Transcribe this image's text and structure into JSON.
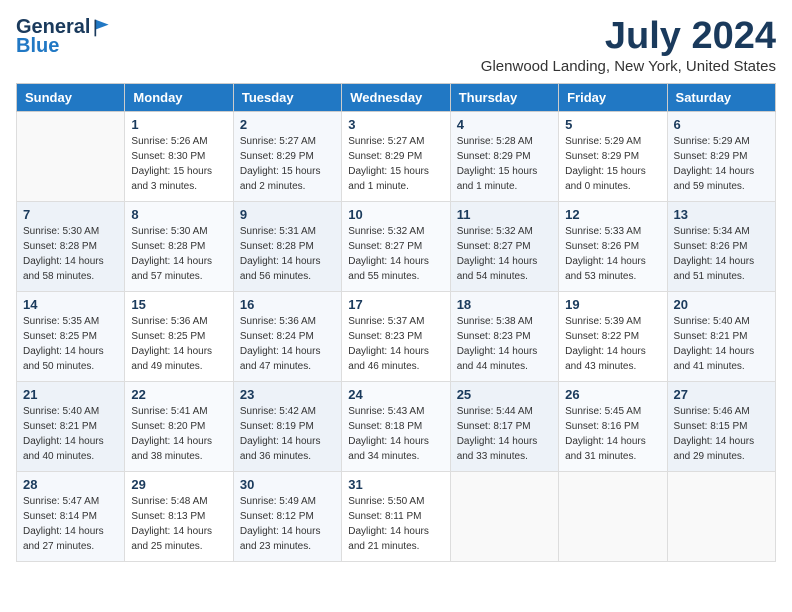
{
  "header": {
    "logo_general": "General",
    "logo_blue": "Blue",
    "month_title": "July 2024",
    "location": "Glenwood Landing, New York, United States"
  },
  "weekdays": [
    "Sunday",
    "Monday",
    "Tuesday",
    "Wednesday",
    "Thursday",
    "Friday",
    "Saturday"
  ],
  "weeks": [
    [
      {
        "day": "",
        "sunrise": "",
        "sunset": "",
        "daylight": ""
      },
      {
        "day": "1",
        "sunrise": "Sunrise: 5:26 AM",
        "sunset": "Sunset: 8:30 PM",
        "daylight": "Daylight: 15 hours and 3 minutes."
      },
      {
        "day": "2",
        "sunrise": "Sunrise: 5:27 AM",
        "sunset": "Sunset: 8:29 PM",
        "daylight": "Daylight: 15 hours and 2 minutes."
      },
      {
        "day": "3",
        "sunrise": "Sunrise: 5:27 AM",
        "sunset": "Sunset: 8:29 PM",
        "daylight": "Daylight: 15 hours and 1 minute."
      },
      {
        "day": "4",
        "sunrise": "Sunrise: 5:28 AM",
        "sunset": "Sunset: 8:29 PM",
        "daylight": "Daylight: 15 hours and 1 minute."
      },
      {
        "day": "5",
        "sunrise": "Sunrise: 5:29 AM",
        "sunset": "Sunset: 8:29 PM",
        "daylight": "Daylight: 15 hours and 0 minutes."
      },
      {
        "day": "6",
        "sunrise": "Sunrise: 5:29 AM",
        "sunset": "Sunset: 8:29 PM",
        "daylight": "Daylight: 14 hours and 59 minutes."
      }
    ],
    [
      {
        "day": "7",
        "sunrise": "Sunrise: 5:30 AM",
        "sunset": "Sunset: 8:28 PM",
        "daylight": "Daylight: 14 hours and 58 minutes."
      },
      {
        "day": "8",
        "sunrise": "Sunrise: 5:30 AM",
        "sunset": "Sunset: 8:28 PM",
        "daylight": "Daylight: 14 hours and 57 minutes."
      },
      {
        "day": "9",
        "sunrise": "Sunrise: 5:31 AM",
        "sunset": "Sunset: 8:28 PM",
        "daylight": "Daylight: 14 hours and 56 minutes."
      },
      {
        "day": "10",
        "sunrise": "Sunrise: 5:32 AM",
        "sunset": "Sunset: 8:27 PM",
        "daylight": "Daylight: 14 hours and 55 minutes."
      },
      {
        "day": "11",
        "sunrise": "Sunrise: 5:32 AM",
        "sunset": "Sunset: 8:27 PM",
        "daylight": "Daylight: 14 hours and 54 minutes."
      },
      {
        "day": "12",
        "sunrise": "Sunrise: 5:33 AM",
        "sunset": "Sunset: 8:26 PM",
        "daylight": "Daylight: 14 hours and 53 minutes."
      },
      {
        "day": "13",
        "sunrise": "Sunrise: 5:34 AM",
        "sunset": "Sunset: 8:26 PM",
        "daylight": "Daylight: 14 hours and 51 minutes."
      }
    ],
    [
      {
        "day": "14",
        "sunrise": "Sunrise: 5:35 AM",
        "sunset": "Sunset: 8:25 PM",
        "daylight": "Daylight: 14 hours and 50 minutes."
      },
      {
        "day": "15",
        "sunrise": "Sunrise: 5:36 AM",
        "sunset": "Sunset: 8:25 PM",
        "daylight": "Daylight: 14 hours and 49 minutes."
      },
      {
        "day": "16",
        "sunrise": "Sunrise: 5:36 AM",
        "sunset": "Sunset: 8:24 PM",
        "daylight": "Daylight: 14 hours and 47 minutes."
      },
      {
        "day": "17",
        "sunrise": "Sunrise: 5:37 AM",
        "sunset": "Sunset: 8:23 PM",
        "daylight": "Daylight: 14 hours and 46 minutes."
      },
      {
        "day": "18",
        "sunrise": "Sunrise: 5:38 AM",
        "sunset": "Sunset: 8:23 PM",
        "daylight": "Daylight: 14 hours and 44 minutes."
      },
      {
        "day": "19",
        "sunrise": "Sunrise: 5:39 AM",
        "sunset": "Sunset: 8:22 PM",
        "daylight": "Daylight: 14 hours and 43 minutes."
      },
      {
        "day": "20",
        "sunrise": "Sunrise: 5:40 AM",
        "sunset": "Sunset: 8:21 PM",
        "daylight": "Daylight: 14 hours and 41 minutes."
      }
    ],
    [
      {
        "day": "21",
        "sunrise": "Sunrise: 5:40 AM",
        "sunset": "Sunset: 8:21 PM",
        "daylight": "Daylight: 14 hours and 40 minutes."
      },
      {
        "day": "22",
        "sunrise": "Sunrise: 5:41 AM",
        "sunset": "Sunset: 8:20 PM",
        "daylight": "Daylight: 14 hours and 38 minutes."
      },
      {
        "day": "23",
        "sunrise": "Sunrise: 5:42 AM",
        "sunset": "Sunset: 8:19 PM",
        "daylight": "Daylight: 14 hours and 36 minutes."
      },
      {
        "day": "24",
        "sunrise": "Sunrise: 5:43 AM",
        "sunset": "Sunset: 8:18 PM",
        "daylight": "Daylight: 14 hours and 34 minutes."
      },
      {
        "day": "25",
        "sunrise": "Sunrise: 5:44 AM",
        "sunset": "Sunset: 8:17 PM",
        "daylight": "Daylight: 14 hours and 33 minutes."
      },
      {
        "day": "26",
        "sunrise": "Sunrise: 5:45 AM",
        "sunset": "Sunset: 8:16 PM",
        "daylight": "Daylight: 14 hours and 31 minutes."
      },
      {
        "day": "27",
        "sunrise": "Sunrise: 5:46 AM",
        "sunset": "Sunset: 8:15 PM",
        "daylight": "Daylight: 14 hours and 29 minutes."
      }
    ],
    [
      {
        "day": "28",
        "sunrise": "Sunrise: 5:47 AM",
        "sunset": "Sunset: 8:14 PM",
        "daylight": "Daylight: 14 hours and 27 minutes."
      },
      {
        "day": "29",
        "sunrise": "Sunrise: 5:48 AM",
        "sunset": "Sunset: 8:13 PM",
        "daylight": "Daylight: 14 hours and 25 minutes."
      },
      {
        "day": "30",
        "sunrise": "Sunrise: 5:49 AM",
        "sunset": "Sunset: 8:12 PM",
        "daylight": "Daylight: 14 hours and 23 minutes."
      },
      {
        "day": "31",
        "sunrise": "Sunrise: 5:50 AM",
        "sunset": "Sunset: 8:11 PM",
        "daylight": "Daylight: 14 hours and 21 minutes."
      },
      {
        "day": "",
        "sunrise": "",
        "sunset": "",
        "daylight": ""
      },
      {
        "day": "",
        "sunrise": "",
        "sunset": "",
        "daylight": ""
      },
      {
        "day": "",
        "sunrise": "",
        "sunset": "",
        "daylight": ""
      }
    ]
  ]
}
